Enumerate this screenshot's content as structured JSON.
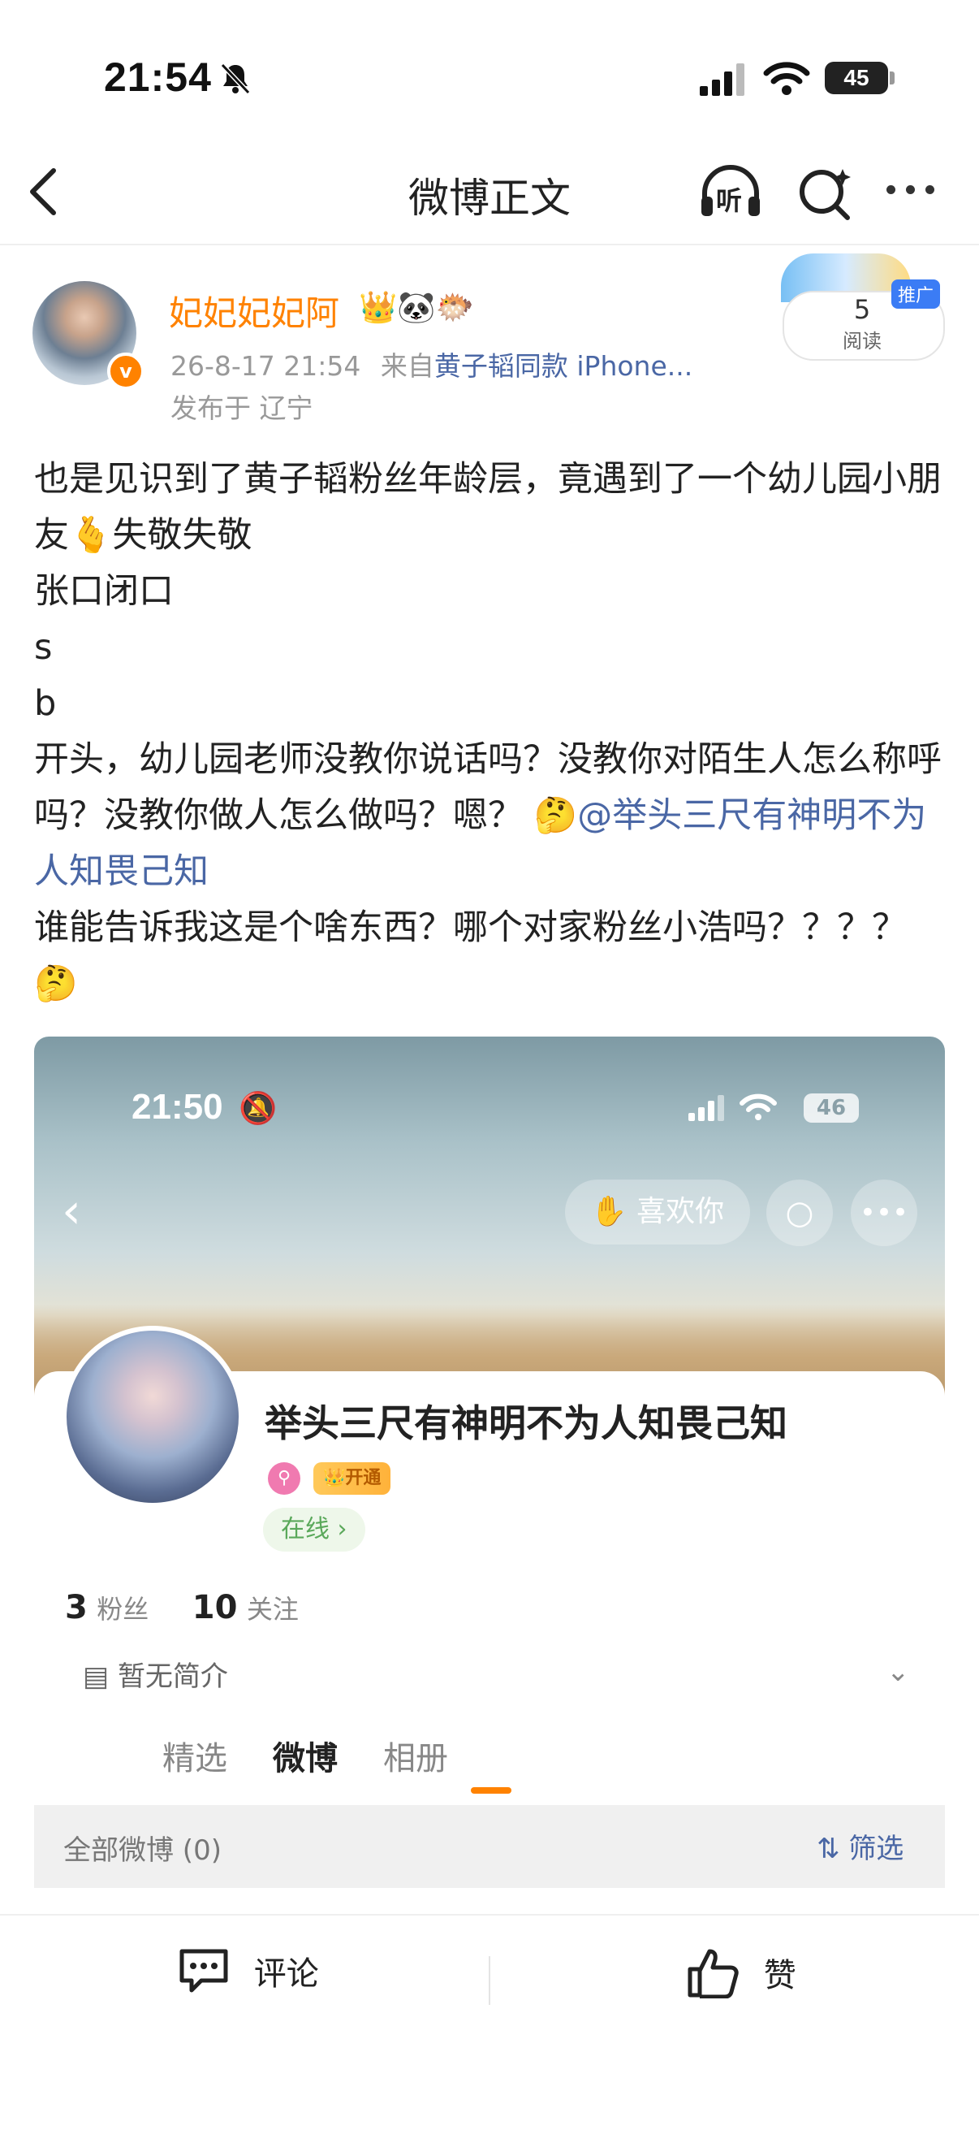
{
  "status_bar": {
    "time": "21:54",
    "battery": "45"
  },
  "nav": {
    "title": "微博正文",
    "listen_label": "听"
  },
  "post": {
    "username": "妃妃妃妃阿",
    "emojis": "👑🐼🐡",
    "date": "26-8-17 21:54",
    "from_prefix": "来自",
    "source": "黄子韬同款 iPhone...",
    "location": "发布于 辽宁",
    "read_count": "5",
    "read_label": "阅读",
    "ad_tag": "推广",
    "lines": {
      "l1": "也是见识到了黄子韬粉丝年龄层，竟遇到了一个幼儿园小朋友",
      "l1_emoji": "🫰",
      "l1_end": "失敬失敬",
      "l2": "张口闭口",
      "l3": "s",
      "l4": "b",
      "l5": "开头，幼儿园老师没教你说话吗？没教你对陌生人怎么称呼吗？没教你做人怎么做吗？嗯？",
      "l5_emoji": "🤔",
      "mention": "@举头三尺有神明不为人知畏己知",
      "l6": "谁能告诉我这是个啥东西？哪个对家粉丝小浩吗？？？？",
      "l6_emoji": "🤔"
    }
  },
  "embedded": {
    "time": "21:50",
    "battery": "46",
    "like_button": "喜欢你",
    "profile_name": "举头三尺有神明不为人知畏己知",
    "vip_label": "开通",
    "online_label": "在线 ›",
    "followers_count": "3",
    "followers_label": "粉丝",
    "following_count": "10",
    "following_label": "关注",
    "intro": "暂无简介",
    "tabs": [
      "精选",
      "微博",
      "相册"
    ],
    "all_posts": "全部微博 (0)",
    "filter": "筛选"
  },
  "bottom": {
    "comment": "评论",
    "like": "赞"
  },
  "colors": {
    "accent": "#ff8200",
    "link": "#4a67a5"
  }
}
